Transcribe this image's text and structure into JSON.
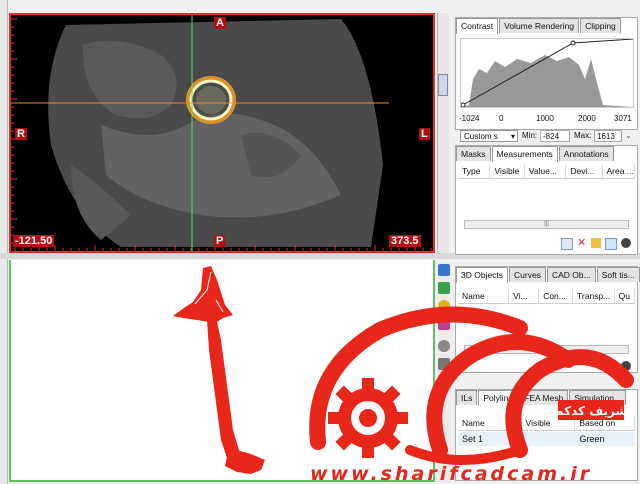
{
  "ct_view": {
    "orientation": {
      "top": "A",
      "bottom": "P",
      "left": "R",
      "right": "L"
    },
    "coord_left": "-121.50",
    "coord_right": "373.5"
  },
  "contrast_panel": {
    "tabs": [
      "Contrast",
      "Volume Rendering",
      "Clipping"
    ],
    "active_tab": "Contrast",
    "axis_ticks": [
      "-1024",
      "0",
      "1000",
      "2000",
      "3071"
    ],
    "preset": "Custom s",
    "min_label": "Min:",
    "min_value": "-824",
    "max_label": "Max:",
    "max_value": "1613"
  },
  "masks_panel": {
    "tabs": [
      "Masks",
      "Measurements",
      "Annotations"
    ],
    "active_tab": "Measurements",
    "columns": [
      "Type",
      "Visible",
      "Value...",
      "Devi...",
      "Area ..."
    ]
  },
  "objects_panel": {
    "tabs": [
      "3D Objects",
      "Curves",
      "CAD Ob...",
      "Soft tis..."
    ],
    "active_tab": "3D Objects",
    "columns": [
      "Name",
      "Vi...",
      "Con...",
      "Transp...",
      "Qu"
    ]
  },
  "bottom_panel": {
    "tabs": [
      "ILs",
      "Polyline",
      "FEA Mesh",
      "Simulation..."
    ],
    "active_tab": "Polyline",
    "columns": [
      "Name",
      "Visible",
      "Based on"
    ],
    "rows": [
      {
        "name": "Set 1",
        "based_on": "Green"
      }
    ]
  },
  "watermark": {
    "url": "www.sharifcadcam.ir",
    "brand_fa": "شریف کدکم"
  },
  "colors": {
    "accent_red": "#e8261a",
    "view_border": "#e23020",
    "green_frame": "#60c060"
  }
}
